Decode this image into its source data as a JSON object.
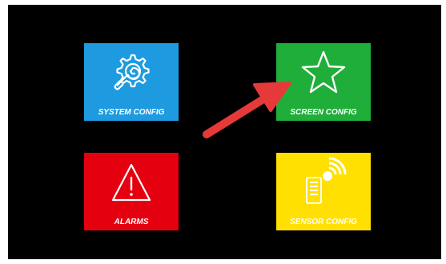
{
  "tiles": [
    {
      "label": "SYSTEM CONFIG",
      "color": "#1e9be0",
      "icon": "gear-wrench-icon"
    },
    {
      "label": "SCREEN CONFIG",
      "color": "#1fae3a",
      "icon": "star-icon"
    },
    {
      "label": "ALARMS",
      "color": "#e4000f",
      "icon": "warning-triangle-icon"
    },
    {
      "label": "SENSOR CONFIG",
      "color": "#ffe000",
      "icon": "wireless-sensor-icon"
    }
  ],
  "annotation": {
    "arrow_color": "#e63a3a",
    "arrow_icon": "pointer-arrow-icon"
  }
}
